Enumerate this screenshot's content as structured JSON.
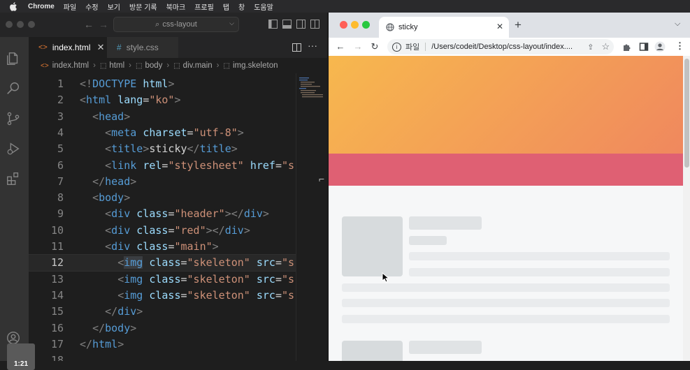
{
  "menubar": {
    "items": [
      "Chrome",
      "파일",
      "수정",
      "보기",
      "방문 기록",
      "북마크",
      "프로필",
      "탭",
      "창",
      "도움말"
    ]
  },
  "vscode": {
    "search": "css-layout",
    "tabs": [
      {
        "label": "index.html",
        "icon": "<>",
        "active": true
      },
      {
        "label": "style.css",
        "icon": "#",
        "active": false
      }
    ],
    "breadcrumb": [
      "index.html",
      "html",
      "body",
      "div.main",
      "img.skeleton"
    ],
    "current_line": 12,
    "clock": "1:21",
    "lines": [
      {
        "n": "1",
        "html": "<span class='p'>&lt;!</span><span class='t'>DOCTYPE</span> <span class='a'>html</span><span class='p'>&gt;</span>"
      },
      {
        "n": "2",
        "html": "<span class='p'>&lt;</span><span class='t'>html</span> <span class='a'>lang</span><span class='x'>=</span><span class='s'>\"ko\"</span><span class='p'>&gt;</span>"
      },
      {
        "n": "3",
        "html": "  <span class='p'>&lt;</span><span class='t'>head</span><span class='p'>&gt;</span>"
      },
      {
        "n": "4",
        "html": "    <span class='p'>&lt;</span><span class='t'>meta</span> <span class='a'>charset</span><span class='x'>=</span><span class='s'>\"utf-8\"</span><span class='p'>&gt;</span>"
      },
      {
        "n": "5",
        "html": "    <span class='p'>&lt;</span><span class='t'>title</span><span class='p'>&gt;</span><span class='x'>sticky</span><span class='p'>&lt;/</span><span class='t'>title</span><span class='p'>&gt;</span>"
      },
      {
        "n": "6",
        "html": "    <span class='p'>&lt;</span><span class='t'>link</span> <span class='a'>rel</span><span class='x'>=</span><span class='s'>\"stylesheet\"</span> <span class='a'>href</span><span class='x'>=</span><span class='s'>\"s</span>"
      },
      {
        "n": "7",
        "html": "  <span class='p'>&lt;/</span><span class='t'>head</span><span class='p'>&gt;</span>"
      },
      {
        "n": "8",
        "html": "  <span class='p'>&lt;</span><span class='t'>body</span><span class='p'>&gt;</span>"
      },
      {
        "n": "9",
        "html": "    <span class='p'>&lt;</span><span class='t'>div</span> <span class='a'>class</span><span class='x'>=</span><span class='s'>\"header\"</span><span class='p'>&gt;&lt;/</span><span class='t'>div</span><span class='p'>&gt;</span>"
      },
      {
        "n": "10",
        "html": "    <span class='p'>&lt;</span><span class='t'>div</span> <span class='a'>class</span><span class='x'>=</span><span class='s'>\"red\"</span><span class='p'>&gt;&lt;/</span><span class='t'>div</span><span class='p'>&gt;</span>"
      },
      {
        "n": "11",
        "html": "    <span class='p'>&lt;</span><span class='t'>div</span> <span class='a'>class</span><span class='x'>=</span><span class='s'>\"main\"</span><span class='p'>&gt;</span>"
      },
      {
        "n": "12",
        "html": "      <span class='p'>&lt;</span><span class='t' style='background:#3a3d41'>img</span> <span class='a'>class</span><span class='x'>=</span><span class='s'>\"skeleton\"</span> <span class='a'>src</span><span class='x'>=</span><span class='s'>\"s</span>"
      },
      {
        "n": "13",
        "html": "      <span class='p'>&lt;</span><span class='t'>img</span> <span class='a'>class</span><span class='x'>=</span><span class='s'>\"skeleton\"</span> <span class='a'>src</span><span class='x'>=</span><span class='s'>\"s</span>"
      },
      {
        "n": "14",
        "html": "      <span class='p'>&lt;</span><span class='t'>img</span> <span class='a'>class</span><span class='x'>=</span><span class='s'>\"skeleton\"</span> <span class='a'>src</span><span class='x'>=</span><span class='s'>\"s</span>"
      },
      {
        "n": "15",
        "html": "    <span class='p'>&lt;/</span><span class='t'>div</span><span class='p'>&gt;</span>"
      },
      {
        "n": "16",
        "html": "  <span class='p'>&lt;/</span><span class='t'>body</span><span class='p'>&gt;</span>"
      },
      {
        "n": "17",
        "html": "<span class='p'>&lt;/</span><span class='t'>html</span><span class='p'>&gt;</span>"
      },
      {
        "n": "18",
        "html": ""
      }
    ]
  },
  "chrome": {
    "tab_title": "sticky",
    "file_label": "파일",
    "url": "/Users/codeit/Desktop/css-layout/index....",
    "colors": {
      "header_start": "#f7b84e",
      "header_end": "#f0885e",
      "red": "#df6073",
      "skeleton": "#d7dbdd"
    }
  }
}
